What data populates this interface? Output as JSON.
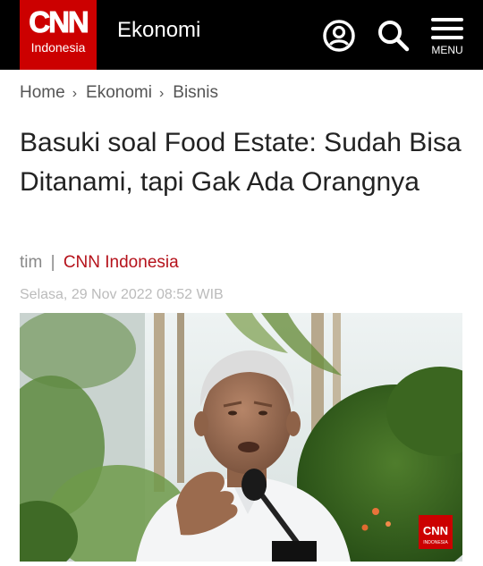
{
  "header": {
    "logo_text": "CNN",
    "logo_sub": "Indonesia",
    "section": "Ekonomi",
    "menu_label": "MENU",
    "icons": [
      "user-icon",
      "search-icon",
      "menu-icon"
    ]
  },
  "breadcrumb": {
    "items": [
      "Home",
      "Ekonomi",
      "Bisnis"
    ],
    "separator": "›"
  },
  "article": {
    "title": "Basuki soal Food Estate: Sudah Bisa Ditanami, tapi Gak Ada Orangnya",
    "author": "tim",
    "separator": "|",
    "source": "CNN Indonesia",
    "date": "Selasa, 29 Nov 2022 08:52 WIB",
    "photo_watermark": "CNN",
    "photo_watermark_sub": "INDONESIA"
  },
  "colors": {
    "brand_red": "#cc0000",
    "header_bg": "#000000",
    "source_red": "#b5121b"
  }
}
